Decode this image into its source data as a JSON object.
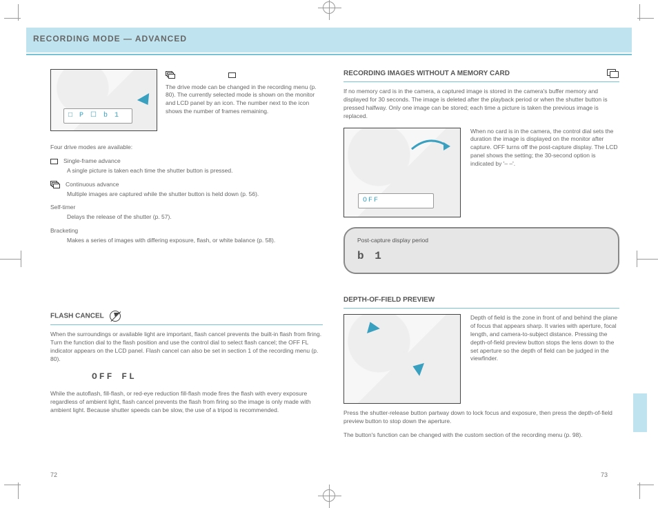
{
  "header": {
    "title": "RECORDING MODE — ADVANCED"
  },
  "left": {
    "fig1_lcd": "□ P  ☐ b 1",
    "intro": "The drive mode can be changed in the recording menu (p. 80). The currently selected mode is shown on the monitor and LCD panel by an icon. The number next to the icon shows the number of frames remaining.",
    "table_intro": "Four drive modes are available:",
    "drive_modes": [
      {
        "label": "Single-frame advance",
        "desc": "A single picture is taken each time the shutter button is pressed."
      },
      {
        "label": "Continuous advance",
        "desc": "Multiple images are captured while the shutter button is held down (p. 56)."
      },
      {
        "label": "Self-timer",
        "desc": "Delays the release of the shutter (p. 57)."
      },
      {
        "label": "Bracketing",
        "desc": "Makes a series of images with differing exposure, flash, or white balance (p. 58)."
      }
    ],
    "flash_cancel": {
      "title": "FLASH CANCEL",
      "body": "When the surroundings or available light are important, flash cancel prevents the built-in flash from firing. Turn the function dial to the flash position and use the control dial to select flash cancel; the OFF FL indicator appears on the LCD panel. Flash cancel can also be set in section 1 of the recording menu (p. 80).",
      "indicator": "OFF  FL",
      "note": "While the autoflash, fill-flash, or red-eye reduction fill-flash mode fires the flash with every exposure regardless of ambient light, flash cancel prevents the flash from firing so the image is only made with ambient light. Because shutter speeds can be slow, the use of a tripod is recommended."
    }
  },
  "right": {
    "no_card": {
      "title": "RECORDING IMAGES WITHOUT A MEMORY CARD",
      "body1": "If no memory card is in the camera, a captured image is stored in the camera's buffer memory and displayed for 30 seconds. The image is deleted after the playback period or when the shutter button is pressed halfway. Only one image can be stored; each time a picture is taken the previous image is replaced.",
      "body2": "When no card is in the camera, the control dial sets the duration the image is displayed on the monitor after capture. OFF turns off the post-capture display. The LCD panel shows the setting; the 30-second option is indicated by '– –'.",
      "info_label": "Post-capture display period",
      "info_value": "b 1",
      "lcd": "OFF"
    },
    "dof": {
      "title": "DEPTH-OF-FIELD PREVIEW",
      "body1": "Depth of field is the zone in front of and behind the plane of focus that appears sharp. It varies with aperture, focal length, and camera-to-subject distance. Pressing the depth-of-field preview button stops the lens down to the set aperture so the depth of field can be judged in the viewfinder.",
      "body2": "Press the shutter-release button partway down to lock focus and exposure, then press the depth-of-field preview button to stop down the aperture.",
      "note": "The button's function can be changed with the custom section of the recording menu (p. 98)."
    }
  },
  "page_numbers": {
    "left": "72",
    "right": "73"
  }
}
